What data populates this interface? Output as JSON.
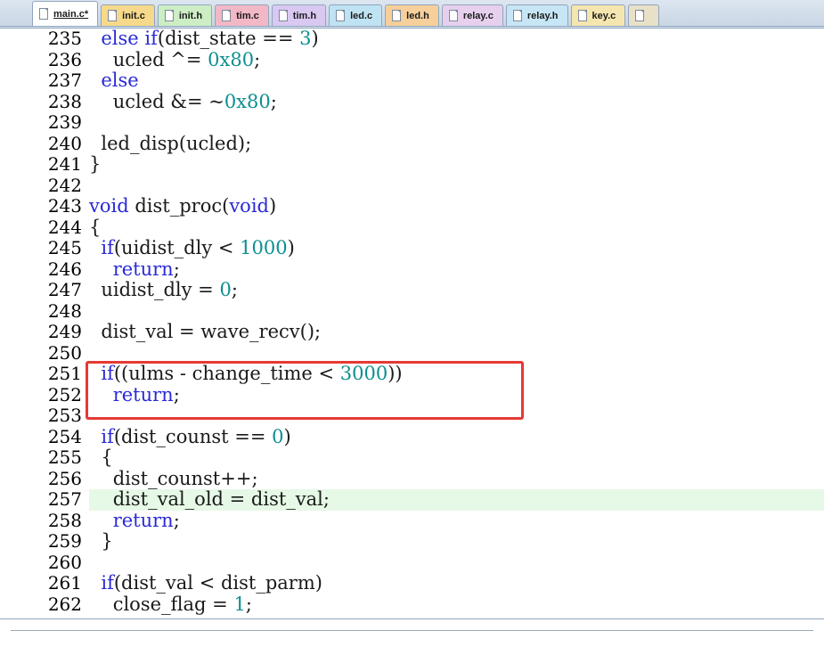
{
  "tabs": [
    {
      "label": "main.c*",
      "active": true,
      "color": "#ffffff",
      "name": "main-c"
    },
    {
      "label": "init.c",
      "active": false,
      "color": "#f6d98a",
      "name": "init-c"
    },
    {
      "label": "init.h",
      "active": false,
      "color": "#cdeec4",
      "name": "init-h"
    },
    {
      "label": "tim.c",
      "active": false,
      "color": "#f2b8c6",
      "name": "tim-c"
    },
    {
      "label": "tim.h",
      "active": false,
      "color": "#d9c8f2",
      "name": "tim-h"
    },
    {
      "label": "led.c",
      "active": false,
      "color": "#bfe3f3",
      "name": "led-c"
    },
    {
      "label": "led.h",
      "active": false,
      "color": "#f6cf9a",
      "name": "led-h"
    },
    {
      "label": "relay.c",
      "active": false,
      "color": "#e7d0ee",
      "name": "relay-c"
    },
    {
      "label": "relay.h",
      "active": false,
      "color": "#c7e6f5",
      "name": "relay-h"
    },
    {
      "label": "key.c",
      "active": false,
      "color": "#f5e6b0",
      "name": "key-c"
    },
    {
      "label": "",
      "active": false,
      "color": "#e9e0c8",
      "name": "more"
    }
  ],
  "editor": {
    "highlighted_line": 257,
    "lines": [
      {
        "num": "235",
        "tokens": [
          [
            "  ",
            "plain"
          ],
          [
            "else",
            "kw"
          ],
          [
            " ",
            "plain"
          ],
          [
            "if",
            "kw"
          ],
          [
            "(dist_state == ",
            "plain"
          ],
          [
            "3",
            "num"
          ],
          [
            ")",
            "plain"
          ]
        ]
      },
      {
        "num": "236",
        "tokens": [
          [
            "    ucled ^= ",
            "plain"
          ],
          [
            "0x80",
            "num"
          ],
          [
            ";",
            "plain"
          ]
        ]
      },
      {
        "num": "237",
        "tokens": [
          [
            "  ",
            "plain"
          ],
          [
            "else",
            "kw"
          ]
        ]
      },
      {
        "num": "238",
        "tokens": [
          [
            "    ucled &= ~",
            "plain"
          ],
          [
            "0x80",
            "num"
          ],
          [
            ";",
            "plain"
          ]
        ]
      },
      {
        "num": "239",
        "tokens": []
      },
      {
        "num": "240",
        "tokens": [
          [
            "  led_disp(ucled);",
            "plain"
          ]
        ]
      },
      {
        "num": "241",
        "tokens": [
          [
            "}",
            "plain"
          ]
        ]
      },
      {
        "num": "242",
        "tokens": []
      },
      {
        "num": "243",
        "tokens": [
          [
            "void",
            "kw"
          ],
          [
            " dist_proc(",
            "plain"
          ],
          [
            "void",
            "kw"
          ],
          [
            ")",
            "plain"
          ]
        ]
      },
      {
        "num": "244",
        "tokens": [
          [
            "{",
            "plain"
          ]
        ]
      },
      {
        "num": "245",
        "tokens": [
          [
            "  ",
            "plain"
          ],
          [
            "if",
            "kw"
          ],
          [
            "(uidist_dly < ",
            "plain"
          ],
          [
            "1000",
            "num"
          ],
          [
            ")",
            "plain"
          ]
        ]
      },
      {
        "num": "246",
        "tokens": [
          [
            "    ",
            "plain"
          ],
          [
            "return",
            "kw"
          ],
          [
            ";",
            "plain"
          ]
        ]
      },
      {
        "num": "247",
        "tokens": [
          [
            "  uidist_dly = ",
            "plain"
          ],
          [
            "0",
            "num"
          ],
          [
            ";",
            "plain"
          ]
        ]
      },
      {
        "num": "248",
        "tokens": []
      },
      {
        "num": "249",
        "tokens": [
          [
            "  dist_val = wave_recv();",
            "plain"
          ]
        ]
      },
      {
        "num": "250",
        "tokens": []
      },
      {
        "num": "251",
        "tokens": [
          [
            "  ",
            "plain"
          ],
          [
            "if",
            "kw"
          ],
          [
            "((ulms - change_time < ",
            "plain"
          ],
          [
            "3000",
            "num"
          ],
          [
            "))",
            "plain"
          ]
        ]
      },
      {
        "num": "252",
        "tokens": [
          [
            "    ",
            "plain"
          ],
          [
            "return",
            "kw"
          ],
          [
            ";",
            "plain"
          ]
        ]
      },
      {
        "num": "253",
        "tokens": []
      },
      {
        "num": "254",
        "tokens": [
          [
            "  ",
            "plain"
          ],
          [
            "if",
            "kw"
          ],
          [
            "(dist_counst == ",
            "plain"
          ],
          [
            "0",
            "num"
          ],
          [
            ")",
            "plain"
          ]
        ]
      },
      {
        "num": "255",
        "tokens": [
          [
            "  {",
            "plain"
          ]
        ]
      },
      {
        "num": "256",
        "tokens": [
          [
            "    dist_counst++;",
            "plain"
          ]
        ]
      },
      {
        "num": "257",
        "tokens": [
          [
            "    dist_val_old = dist_val;",
            "plain"
          ]
        ]
      },
      {
        "num": "258",
        "tokens": [
          [
            "    ",
            "plain"
          ],
          [
            "return",
            "kw"
          ],
          [
            ";",
            "plain"
          ]
        ]
      },
      {
        "num": "259",
        "tokens": [
          [
            "  }",
            "plain"
          ]
        ]
      },
      {
        "num": "260",
        "tokens": []
      },
      {
        "num": "261",
        "tokens": [
          [
            "  ",
            "plain"
          ],
          [
            "if",
            "kw"
          ],
          [
            "(dist_val < dist_parm)",
            "plain"
          ]
        ]
      },
      {
        "num": "262",
        "tokens": [
          [
            "    close_flag = ",
            "plain"
          ],
          [
            "1",
            "num"
          ],
          [
            ";",
            "plain"
          ]
        ]
      }
    ]
  },
  "colors": {
    "keyword": "#2a2ad8",
    "number": "#0d8f8f",
    "highlight": "#e6f8e6",
    "annotation": "#e53935"
  }
}
